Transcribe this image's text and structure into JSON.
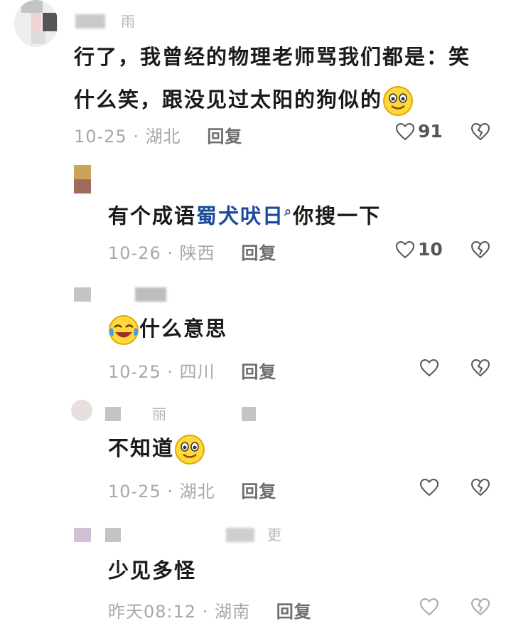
{
  "comments": [
    {
      "text_a": "行了，我曾经的物理老师骂我们都是：笑",
      "text_b": "什么笑，跟没见过太阳的狗似的",
      "date": "10-25",
      "location": "湖北",
      "reply_label": "回复",
      "likes": "91",
      "name_fragment": "雨"
    },
    {
      "text_before": "有个成语",
      "idiom_link": "蜀犬吠日",
      "text_after": "你搜一下",
      "date": "10-26",
      "location": "陕西",
      "reply_label": "回复",
      "likes": "10"
    },
    {
      "text": "什么意思",
      "date": "10-25",
      "location": "四川",
      "reply_label": "回复"
    },
    {
      "text": "不知道",
      "date": "10-25",
      "location": "湖北",
      "reply_label": "回复",
      "name_fragment": "丽"
    },
    {
      "text": "少见多怪",
      "date": "昨天08:12",
      "location": "湖南",
      "reply_label": "回复",
      "name_fragment": "更"
    }
  ],
  "separator": "·",
  "icons": {
    "like": "heart-outline-icon",
    "dislike": "broken-heart-icon",
    "emoji_smile": "smiling-face-emoji",
    "emoji_laugh": "laughing-tears-emoji",
    "search": "search-icon"
  },
  "colors": {
    "link": "#1c4b9c",
    "meta": "#a8a8a8",
    "text": "#1a1a1a"
  }
}
